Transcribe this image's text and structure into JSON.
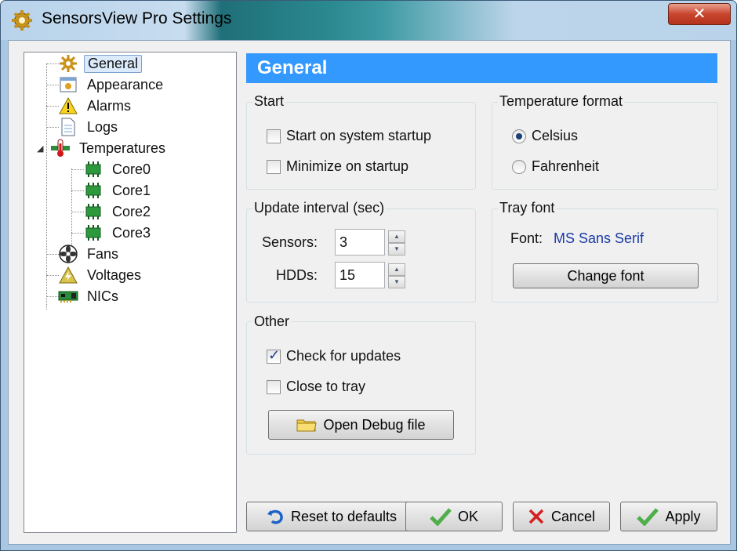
{
  "window": {
    "title": "SensorsView Pro Settings",
    "close_label": "✕"
  },
  "tree": {
    "items": [
      {
        "label": "General",
        "icon": "gear-icon"
      },
      {
        "label": "Appearance",
        "icon": "appearance-icon"
      },
      {
        "label": "Alarms",
        "icon": "warning-icon"
      },
      {
        "label": "Logs",
        "icon": "document-icon"
      },
      {
        "label": "Temperatures",
        "icon": "thermometer-icon"
      },
      {
        "label": "Core0",
        "icon": "chip-icon"
      },
      {
        "label": "Core1",
        "icon": "chip-icon"
      },
      {
        "label": "Core2",
        "icon": "chip-icon"
      },
      {
        "label": "Core3",
        "icon": "chip-icon"
      },
      {
        "label": "Fans",
        "icon": "fan-icon"
      },
      {
        "label": "Voltages",
        "icon": "voltage-icon"
      },
      {
        "label": "NICs",
        "icon": "network-card-icon"
      }
    ]
  },
  "header": {
    "title": "General"
  },
  "start": {
    "title": "Start",
    "startup_label": "Start on system startup",
    "startup_checked": false,
    "minimize_label": "Minimize on startup",
    "minimize_checked": false
  },
  "temperature_format": {
    "title": "Temperature format",
    "celsius_label": "Celsius",
    "fahrenheit_label": "Fahrenheit",
    "selected": "Celsius"
  },
  "update_interval": {
    "title": "Update interval (sec)",
    "sensors_label": "Sensors:",
    "sensors_value": "3",
    "hdds_label": "HDDs:",
    "hdds_value": "15"
  },
  "tray_font": {
    "title": "Tray font",
    "font_label": "Font:",
    "font_value": "MS Sans Serif",
    "change_label": "Change font"
  },
  "other": {
    "title": "Other",
    "updates_label": "Check for updates",
    "updates_checked": true,
    "tray_label": "Close to tray",
    "tray_checked": false,
    "debug_label": "Open Debug file"
  },
  "footer": {
    "reset_label": "Reset to defaults",
    "ok_label": "OK",
    "cancel_label": "Cancel",
    "apply_label": "Apply"
  },
  "colors": {
    "header_bg": "#3399ff",
    "font_value": "#1a3aa8"
  }
}
